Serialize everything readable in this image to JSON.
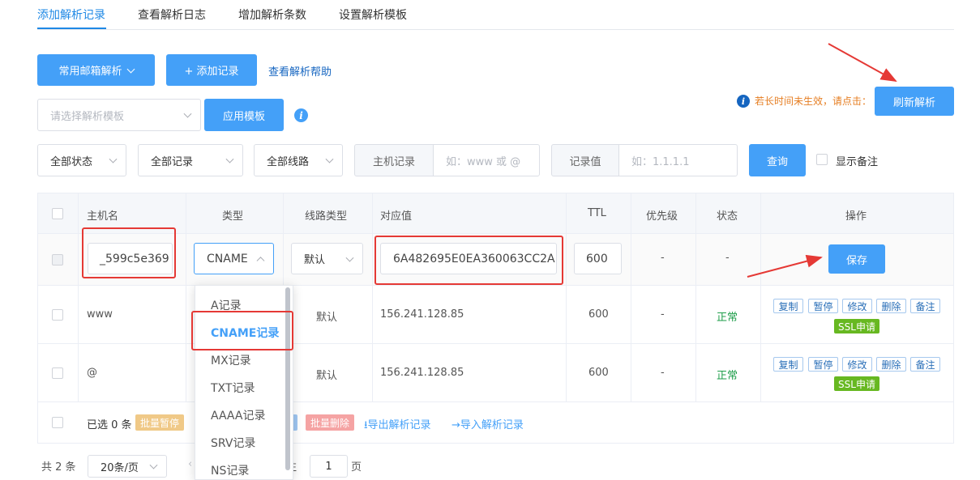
{
  "tabs": [
    {
      "label": "添加解析记录",
      "active": true
    },
    {
      "label": "查看解析日志",
      "active": false
    },
    {
      "label": "增加解析条数",
      "active": false
    },
    {
      "label": "设置解析模板",
      "active": false
    }
  ],
  "toolbar": {
    "mail_button": "常用邮箱解析",
    "add_button": "+ 添加记录",
    "help_link": "查看解析帮助",
    "template_placeholder": "请选择解析模板",
    "apply_button": "应用模板",
    "notice_text": "若长时间未生效，请点击：",
    "refresh_button": "刷新解析"
  },
  "filters": {
    "status": "全部状态",
    "records": "全部记录",
    "lines": "全部线路",
    "host_label": "主机记录",
    "host_placeholder": "如：www 或 @",
    "value_label": "记录值",
    "value_placeholder": "如：1.1.1.1",
    "query_button": "查询",
    "show_remark": "显示备注"
  },
  "table": {
    "headers": [
      "主机名",
      "类型",
      "线路类型",
      "对应值",
      "TTL",
      "优先级",
      "状态",
      "操作"
    ],
    "edit_row": {
      "host": "_599c5e369",
      "type": "CNAME",
      "line": "默认",
      "value": "6A482695E0EA360063CC2A",
      "ttl": "600",
      "priority": "-",
      "status": "-",
      "save": "保存"
    },
    "rows": [
      {
        "host": "www",
        "line": "默认",
        "value": "156.241.128.85",
        "ttl": "600",
        "priority": "-",
        "status": "正常"
      },
      {
        "host": "@",
        "line": "默认",
        "value": "156.241.128.85",
        "ttl": "600",
        "priority": "-",
        "status": "正常"
      }
    ],
    "ops": [
      "复制",
      "暂停",
      "修改",
      "删除",
      "备注"
    ],
    "ssl": "SSL申请",
    "footer": {
      "selected": "已选 0 条",
      "batch_pause": "批量暂停",
      "batch_delete": "批量删除",
      "export": "⭳导出解析记录",
      "import": "→导入解析记录"
    }
  },
  "type_dropdown": {
    "options": [
      "A记录",
      "CNAME记录",
      "MX记录",
      "TXT记录",
      "AAAA记录",
      "SRV记录",
      "NS记录"
    ],
    "selected": "CNAME记录"
  },
  "pagination": {
    "total": "共 2 条",
    "page_size": "20条/页",
    "goto_prefix": "前往",
    "page": "1",
    "page_suffix": "页"
  },
  "colors": {
    "primary": "#44a0f8",
    "link": "#1565c0",
    "success": "#1e9e4a",
    "annotation": "#e53935"
  }
}
